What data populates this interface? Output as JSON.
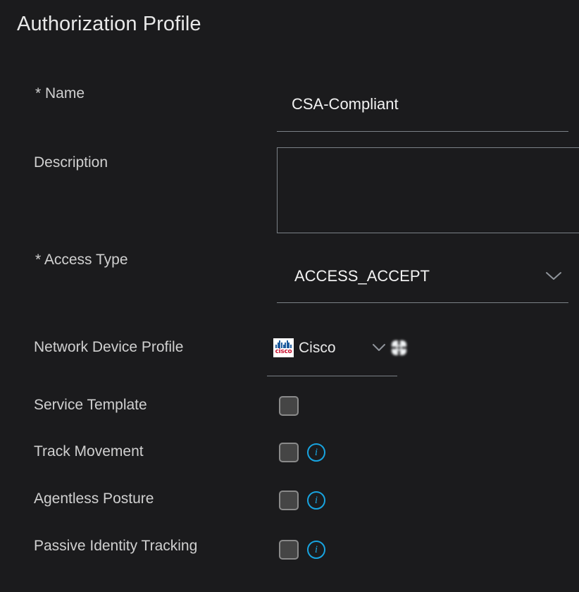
{
  "page": {
    "title": "Authorization Profile"
  },
  "form": {
    "name": {
      "label": "* Name",
      "value": "CSA-Compliant",
      "placeholder": ""
    },
    "description": {
      "label": "Description",
      "value": "",
      "placeholder": ""
    },
    "access_type": {
      "label": "* Access Type",
      "value": "ACCESS_ACCEPT",
      "chevron_icon": "chevron-down-icon"
    },
    "network_device_profile": {
      "label": "Network Device Profile",
      "value": "Cisco",
      "logo_icon": "cisco-logo-icon",
      "logo_wordmark": "cisco",
      "chevron_icon": "chevron-down-icon",
      "gear_icon": "gear-icon"
    },
    "checkboxes": [
      {
        "label": "Service Template",
        "checked": false,
        "has_info": false,
        "info_icon": ""
      },
      {
        "label": "Track Movement",
        "checked": false,
        "has_info": true,
        "info_icon": "info-icon"
      },
      {
        "label": "Agentless Posture",
        "checked": false,
        "has_info": true,
        "info_icon": "info-icon"
      },
      {
        "label": "Passive Identity Tracking",
        "checked": false,
        "has_info": true,
        "info_icon": "info-icon"
      }
    ]
  },
  "colors": {
    "background": "#1b1b1d",
    "text_primary": "#e8e8e8",
    "text_label": "#d0d0d0",
    "underline": "#7b8187",
    "checkbox_fill": "#454545",
    "checkbox_border": "#8a8a8a",
    "info_blue": "#18a4e0",
    "cisco_red": "#c8102e",
    "cisco_blue": "#1f5c9e"
  }
}
